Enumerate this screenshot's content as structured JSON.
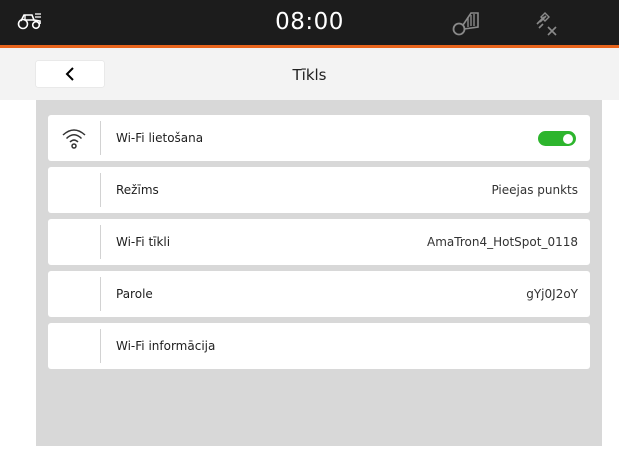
{
  "status_bar": {
    "time": "08:00",
    "icons": [
      "tractor-icon",
      "implement-icon",
      "gps-disconnected-icon"
    ]
  },
  "header": {
    "back_icon": "chevron-left-icon",
    "title": "Tīkls"
  },
  "settings": [
    {
      "icon": "wifi-icon",
      "label": "Wi-Fi lietošana",
      "toggle_on": true
    },
    {
      "label": "Režīms",
      "value": "Pieejas punkts"
    },
    {
      "label": "Wi-Fi tīkli",
      "value": "AmaTron4_HotSpot_0118"
    },
    {
      "label": "Parole",
      "value": "gYj0J2oY"
    },
    {
      "label": "Wi-Fi informācija"
    }
  ],
  "colors": {
    "status_bar_bg": "#1c1c1c",
    "accent_orange": "#e8641c",
    "toggle_on": "#2db52d",
    "panel_bg": "#d8d8d8"
  }
}
